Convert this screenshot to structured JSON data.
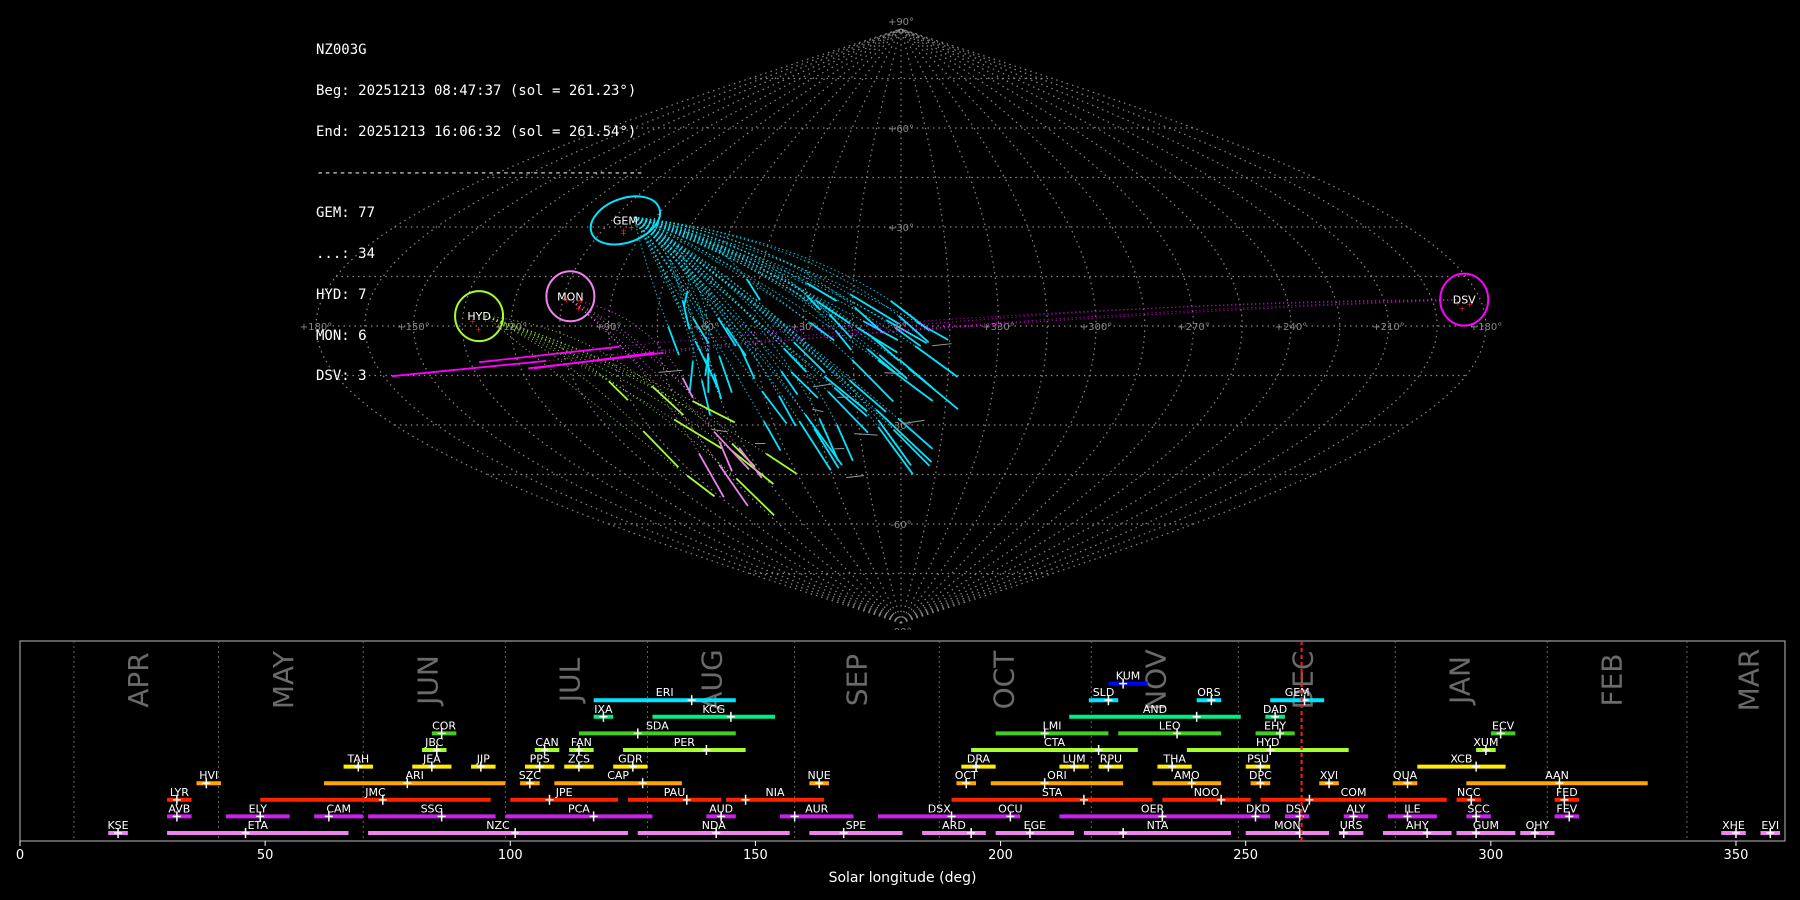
{
  "info": {
    "station": "NZ003G",
    "begin": "Beg: 20251213 08:47:37 (sol = 261.23°)",
    "end": "End: 20251213 16:06:32 (sol = 261.54°)",
    "separator": "--------------------------------------------",
    "counts": [
      "GEM: 77",
      "...: 34",
      "HYD: 7",
      "MON: 6",
      "DSV: 3"
    ]
  },
  "sky_map": {
    "projection": "sinusoidal",
    "lat_labels": [
      "+90°",
      "+60°",
      "+30°",
      "0°",
      "-30°",
      "-60°",
      "-90°"
    ],
    "lon_labels": [
      "+180°",
      "+150°",
      "+120°",
      "+90°",
      "+60°",
      "+30°",
      "0°",
      "+330°",
      "+300°",
      "+270°",
      "+240°",
      "+210°",
      "+180°"
    ],
    "showers": [
      {
        "code": "GEM",
        "color": "#00e5ff",
        "lon": 100,
        "lat": 32,
        "count": 77
      },
      {
        "code": "MON",
        "color": "#ee82ee",
        "lon": 103,
        "lat": 9,
        "count": 6
      },
      {
        "code": "HYD",
        "color": "#a4ff2f",
        "lon": 130,
        "lat": 3,
        "count": 7
      },
      {
        "code": "DSV",
        "color": "#ff00ff",
        "lon": -175,
        "lat": 8,
        "count": 3
      }
    ],
    "sporadic_label": "..."
  },
  "chart_data": {
    "type": "timeline",
    "xlabel": "Solar longitude (deg)",
    "xlim": [
      0,
      360
    ],
    "xticks": [
      0,
      50,
      100,
      150,
      200,
      250,
      300,
      350
    ],
    "current_sol": 261.4,
    "months": [
      {
        "name": "APR",
        "sol": 24.5
      },
      {
        "name": "MAY",
        "sol": 54
      },
      {
        "name": "JUN",
        "sol": 83.5
      },
      {
        "name": "JUL",
        "sol": 112.5
      },
      {
        "name": "AUG",
        "sol": 141.5
      },
      {
        "name": "SEP",
        "sol": 171
      },
      {
        "name": "OCT",
        "sol": 201
      },
      {
        "name": "NOV",
        "sol": 232
      },
      {
        "name": "DEC",
        "sol": 262
      },
      {
        "name": "JAN",
        "sol": 294
      },
      {
        "name": "FEB",
        "sol": 325
      },
      {
        "name": "MAR",
        "sol": 353
      }
    ],
    "month_boundaries": [
      11,
      40.5,
      70,
      99,
      128,
      158,
      187.5,
      218.5,
      248.5,
      280.5,
      311.5,
      340
    ],
    "showers": [
      {
        "code": "KUM",
        "start": 222,
        "end": 230,
        "peak": 225,
        "row": 9,
        "color": "#0000ff"
      },
      {
        "code": "ERI",
        "start": 117,
        "end": 146,
        "peak": 137,
        "row": 8,
        "color": "#00e5ff"
      },
      {
        "code": "SLD",
        "start": 218,
        "end": 224,
        "peak": 222,
        "row": 8,
        "color": "#00e5ff"
      },
      {
        "code": "ORS",
        "start": 240,
        "end": 245,
        "peak": 243,
        "row": 8,
        "color": "#00e5ff"
      },
      {
        "code": "GEM",
        "start": 255,
        "end": 266,
        "peak": 262,
        "row": 8,
        "color": "#00e5ff"
      },
      {
        "code": "IXA",
        "start": 117,
        "end": 121,
        "peak": 119,
        "row": 7,
        "color": "#00ee88"
      },
      {
        "code": "KCG",
        "start": 129,
        "end": 154,
        "peak": 145,
        "row": 7,
        "color": "#00ee88"
      },
      {
        "code": "AND",
        "start": 214,
        "end": 249,
        "peak": 240,
        "row": 7,
        "color": "#00ee88"
      },
      {
        "code": "DAD",
        "start": 254,
        "end": 258,
        "peak": 256,
        "row": 7,
        "color": "#00ee88"
      },
      {
        "code": "COR",
        "start": 84,
        "end": 89,
        "peak": 86,
        "row": 6,
        "color": "#44cc22"
      },
      {
        "code": "SDA",
        "start": 114,
        "end": 146,
        "peak": 126,
        "row": 6,
        "color": "#44cc22"
      },
      {
        "code": "LMI",
        "start": 199,
        "end": 222,
        "peak": 209,
        "row": 6,
        "color": "#44cc22"
      },
      {
        "code": "LEO",
        "start": 224,
        "end": 245,
        "peak": 236,
        "row": 6,
        "color": "#44cc22"
      },
      {
        "code": "EHY",
        "start": 252,
        "end": 260,
        "peak": 257,
        "row": 6,
        "color": "#44cc22"
      },
      {
        "code": "ECV",
        "start": 300,
        "end": 305,
        "peak": 302,
        "row": 6,
        "color": "#44cc22"
      },
      {
        "code": "JBC",
        "start": 82,
        "end": 87,
        "peak": 85,
        "row": 5,
        "color": "#a4ff2f"
      },
      {
        "code": "CAN",
        "start": 105,
        "end": 110,
        "peak": 107,
        "row": 5,
        "color": "#a4ff2f"
      },
      {
        "code": "FAN",
        "start": 112,
        "end": 117,
        "peak": 114,
        "row": 5,
        "color": "#a4ff2f"
      },
      {
        "code": "PER",
        "start": 123,
        "end": 148,
        "peak": 140,
        "row": 5,
        "color": "#a4ff2f"
      },
      {
        "code": "CTA",
        "start": 194,
        "end": 228,
        "peak": 220,
        "row": 5,
        "color": "#a4ff2f"
      },
      {
        "code": "HYD",
        "start": 238,
        "end": 271,
        "peak": 255,
        "row": 5,
        "color": "#a4ff2f"
      },
      {
        "code": "XUM",
        "start": 297,
        "end": 301,
        "peak": 299,
        "row": 5,
        "color": "#a4ff2f"
      },
      {
        "code": "TAH",
        "start": 66,
        "end": 72,
        "peak": 69,
        "row": 4,
        "color": "#ffee00"
      },
      {
        "code": "JEA",
        "start": 80,
        "end": 88,
        "peak": 84,
        "row": 4,
        "color": "#ffee00"
      },
      {
        "code": "JIP",
        "start": 92,
        "end": 97,
        "peak": 94,
        "row": 4,
        "color": "#ffee00"
      },
      {
        "code": "PPS",
        "start": 103,
        "end": 109,
        "peak": 106,
        "row": 4,
        "color": "#ffee00"
      },
      {
        "code": "ZCS",
        "start": 111,
        "end": 117,
        "peak": 114,
        "row": 4,
        "color": "#ffee00"
      },
      {
        "code": "GDR",
        "start": 121,
        "end": 128,
        "peak": 125,
        "row": 4,
        "color": "#ffee00"
      },
      {
        "code": "DRA",
        "start": 192,
        "end": 199,
        "peak": 195,
        "row": 4,
        "color": "#ffee00"
      },
      {
        "code": "LUM",
        "start": 212,
        "end": 218,
        "peak": 215,
        "row": 4,
        "color": "#ffee00"
      },
      {
        "code": "RPU",
        "start": 220,
        "end": 225,
        "peak": 222,
        "row": 4,
        "color": "#ffee00"
      },
      {
        "code": "THA",
        "start": 232,
        "end": 239,
        "peak": 235,
        "row": 4,
        "color": "#ffee00"
      },
      {
        "code": "PSU",
        "start": 250,
        "end": 255,
        "peak": 253,
        "row": 4,
        "color": "#ffee00"
      },
      {
        "code": "XCB",
        "start": 285,
        "end": 303,
        "peak": 297,
        "row": 4,
        "color": "#ffee00"
      },
      {
        "code": "HVI",
        "start": 36,
        "end": 41,
        "peak": 38,
        "row": 3,
        "color": "#ffa500"
      },
      {
        "code": "ARI",
        "start": 62,
        "end": 99,
        "peak": 79,
        "row": 3,
        "color": "#ffa500"
      },
      {
        "code": "SZC",
        "start": 102,
        "end": 106,
        "peak": 104,
        "row": 3,
        "color": "#ffa500"
      },
      {
        "code": "CAP",
        "start": 109,
        "end": 135,
        "peak": 127,
        "row": 3,
        "color": "#ffa500"
      },
      {
        "code": "NUE",
        "start": 161,
        "end": 165,
        "peak": 163,
        "row": 3,
        "color": "#ffa500"
      },
      {
        "code": "OCT",
        "start": 191,
        "end": 195,
        "peak": 193,
        "row": 3,
        "color": "#ffa500"
      },
      {
        "code": "ORI",
        "start": 198,
        "end": 225,
        "peak": 209,
        "row": 3,
        "color": "#ffa500"
      },
      {
        "code": "AMO",
        "start": 231,
        "end": 245,
        "peak": 239,
        "row": 3,
        "color": "#ffa500"
      },
      {
        "code": "DPC",
        "start": 251,
        "end": 255,
        "peak": 253,
        "row": 3,
        "color": "#ffa500"
      },
      {
        "code": "XVI",
        "start": 265,
        "end": 269,
        "peak": 267,
        "row": 3,
        "color": "#ffa500"
      },
      {
        "code": "QUA",
        "start": 280,
        "end": 285,
        "peak": 283,
        "row": 3,
        "color": "#ffa500"
      },
      {
        "code": "AAN",
        "start": 295,
        "end": 332,
        "peak": 314,
        "row": 3,
        "color": "#ffa500"
      },
      {
        "code": "LYR",
        "start": 30,
        "end": 35,
        "peak": 32,
        "row": 2,
        "color": "#ff2200"
      },
      {
        "code": "JMC",
        "start": 49,
        "end": 96,
        "peak": 74,
        "row": 2,
        "color": "#ff2200"
      },
      {
        "code": "JPE",
        "start": 100,
        "end": 122,
        "peak": 108,
        "row": 2,
        "color": "#ff2200"
      },
      {
        "code": "PAU",
        "start": 124,
        "end": 143,
        "peak": 136,
        "row": 2,
        "color": "#ff2200"
      },
      {
        "code": "NIA",
        "start": 144,
        "end": 164,
        "peak": 148,
        "row": 2,
        "color": "#ff2200"
      },
      {
        "code": "STA",
        "start": 190,
        "end": 231,
        "peak": 217,
        "row": 2,
        "color": "#ff2200"
      },
      {
        "code": "NOO",
        "start": 233,
        "end": 251,
        "peak": 245,
        "row": 2,
        "color": "#ff2200"
      },
      {
        "code": "COM",
        "start": 253,
        "end": 291,
        "peak": 263,
        "row": 2,
        "color": "#ff2200"
      },
      {
        "code": "NCC",
        "start": 293,
        "end": 298,
        "peak": 296,
        "row": 2,
        "color": "#ff2200"
      },
      {
        "code": "FED",
        "start": 313,
        "end": 318,
        "peak": 315,
        "row": 2,
        "color": "#ff2200"
      },
      {
        "code": "AVB",
        "start": 30,
        "end": 35,
        "peak": 32,
        "row": 1,
        "color": "#cc22ee"
      },
      {
        "code": "ELY",
        "start": 42,
        "end": 55,
        "peak": 49,
        "row": 1,
        "color": "#cc22ee"
      },
      {
        "code": "CAM",
        "start": 60,
        "end": 70,
        "peak": 63,
        "row": 1,
        "color": "#cc22ee"
      },
      {
        "code": "SSG",
        "start": 71,
        "end": 97,
        "peak": 86,
        "row": 1,
        "color": "#cc22ee"
      },
      {
        "code": "PCA",
        "start": 99,
        "end": 129,
        "peak": 117,
        "row": 1,
        "color": "#cc22ee"
      },
      {
        "code": "AUD",
        "start": 140,
        "end": 146,
        "peak": 143,
        "row": 1,
        "color": "#cc22ee"
      },
      {
        "code": "AUR",
        "start": 155,
        "end": 170,
        "peak": 158,
        "row": 1,
        "color": "#cc22ee"
      },
      {
        "code": "DSX",
        "start": 175,
        "end": 200,
        "peak": 190,
        "row": 1,
        "color": "#cc22ee"
      },
      {
        "code": "OCU",
        "start": 200,
        "end": 204,
        "peak": 202,
        "row": 1,
        "color": "#cc22ee"
      },
      {
        "code": "OER",
        "start": 212,
        "end": 250,
        "peak": 233,
        "row": 1,
        "color": "#cc22ee"
      },
      {
        "code": "DKD",
        "start": 250,
        "end": 255,
        "peak": 252,
        "row": 1,
        "color": "#cc22ee"
      },
      {
        "code": "DSV",
        "start": 258,
        "end": 263,
        "peak": 261,
        "row": 1,
        "color": "#cc22ee"
      },
      {
        "code": "ALY",
        "start": 270,
        "end": 275,
        "peak": 272,
        "row": 1,
        "color": "#cc22ee"
      },
      {
        "code": "ILE",
        "start": 279,
        "end": 289,
        "peak": 283,
        "row": 1,
        "color": "#cc22ee"
      },
      {
        "code": "SCC",
        "start": 295,
        "end": 300,
        "peak": 297,
        "row": 1,
        "color": "#cc22ee"
      },
      {
        "code": "FEV",
        "start": 313,
        "end": 318,
        "peak": 316,
        "row": 1,
        "color": "#cc22ee"
      },
      {
        "code": "KSE",
        "start": 18,
        "end": 22,
        "peak": 20,
        "row": 0,
        "color": "#ee82ee"
      },
      {
        "code": "ETA",
        "start": 30,
        "end": 67,
        "peak": 46,
        "row": 0,
        "color": "#ee82ee"
      },
      {
        "code": "NZC",
        "start": 71,
        "end": 124,
        "peak": 101,
        "row": 0,
        "color": "#ee82ee"
      },
      {
        "code": "NDA",
        "start": 126,
        "end": 157,
        "peak": 142,
        "row": 0,
        "color": "#ee82ee"
      },
      {
        "code": "SPE",
        "start": 161,
        "end": 180,
        "peak": 168,
        "row": 0,
        "color": "#ee82ee"
      },
      {
        "code": "ARD",
        "start": 184,
        "end": 197,
        "peak": 194,
        "row": 0,
        "color": "#ee82ee"
      },
      {
        "code": "EGE",
        "start": 199,
        "end": 215,
        "peak": 206,
        "row": 0,
        "color": "#ee82ee"
      },
      {
        "code": "NTA",
        "start": 217,
        "end": 247,
        "peak": 225,
        "row": 0,
        "color": "#ee82ee"
      },
      {
        "code": "MON",
        "start": 250,
        "end": 267,
        "peak": 261,
        "row": 0,
        "color": "#ee82ee"
      },
      {
        "code": "URS",
        "start": 269,
        "end": 274,
        "peak": 270,
        "row": 0,
        "color": "#ee82ee"
      },
      {
        "code": "AHY",
        "start": 278,
        "end": 292,
        "peak": 287,
        "row": 0,
        "color": "#ee82ee"
      },
      {
        "code": "GUM",
        "start": 293,
        "end": 305,
        "peak": 297,
        "row": 0,
        "color": "#ee82ee"
      },
      {
        "code": "OHY",
        "start": 306,
        "end": 313,
        "peak": 309,
        "row": 0,
        "color": "#ee82ee"
      },
      {
        "code": "XHE",
        "start": 347,
        "end": 352,
        "peak": 350,
        "row": 0,
        "color": "#ee82ee"
      },
      {
        "code": "EVI",
        "start": 355,
        "end": 359,
        "peak": 357,
        "row": 0,
        "color": "#ee82ee"
      }
    ]
  }
}
